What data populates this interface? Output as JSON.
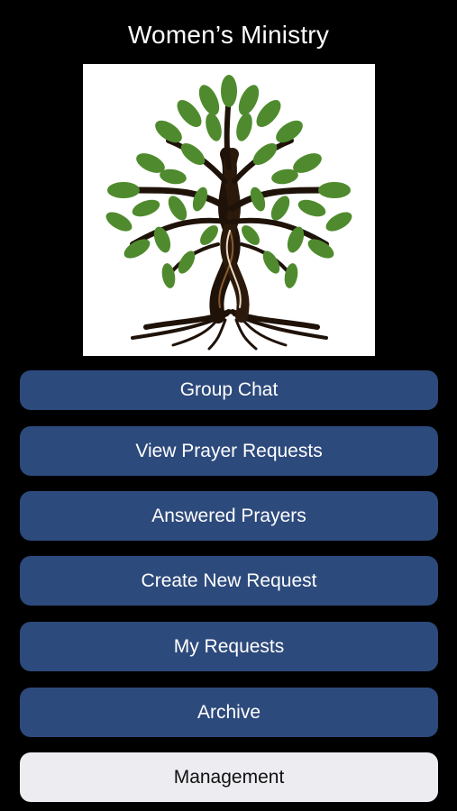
{
  "header": {
    "title": "Women’s Ministry"
  },
  "logo": {
    "icon": "tree-logo-icon"
  },
  "menu": {
    "items": [
      {
        "label": "Group Chat"
      },
      {
        "label": "View Prayer Requests"
      },
      {
        "label": "Answered Prayers"
      },
      {
        "label": "Create New Request"
      },
      {
        "label": "My Requests"
      },
      {
        "label": "Archive"
      },
      {
        "label": "Management"
      }
    ]
  },
  "colors": {
    "background": "#000000",
    "primary_button": "#2d4a7c",
    "secondary_button": "#ececf1",
    "leaf_green": "#4f8b2e",
    "trunk": "#1f1208"
  }
}
